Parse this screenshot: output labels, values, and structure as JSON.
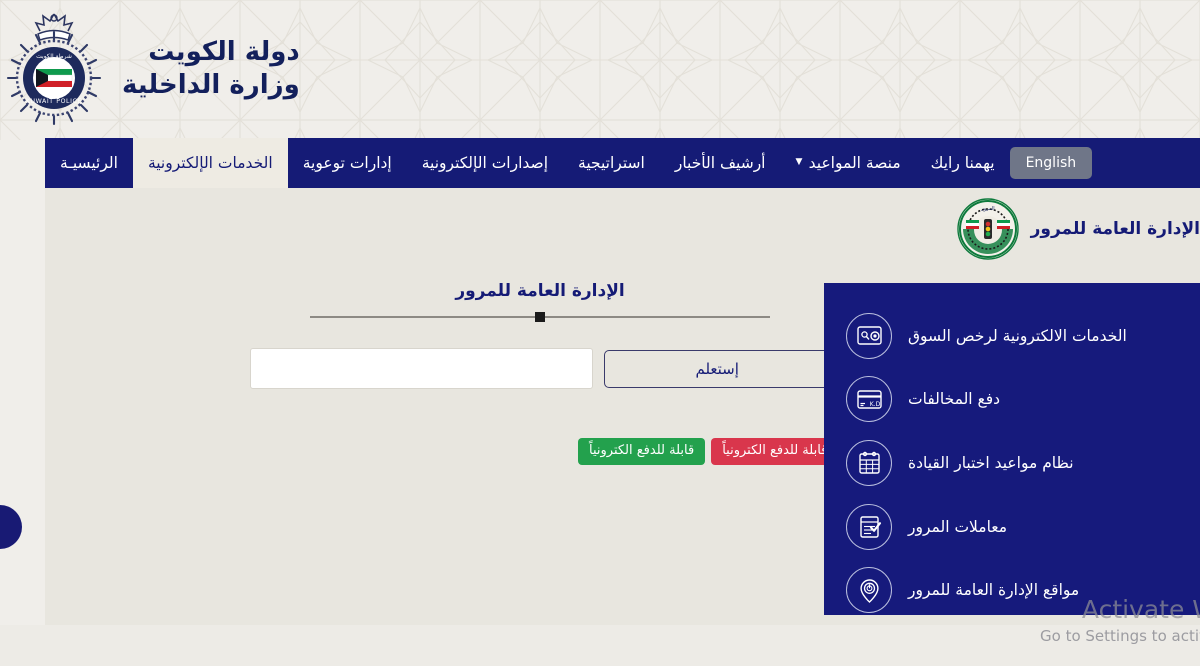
{
  "header": {
    "ministry_line1": "دولة الكويت",
    "ministry_line2": "وزارة الداخلية",
    "emblem_name": "kuwait-police-emblem",
    "emblem_text_top": "شرطــة الكويت",
    "emblem_text_bottom": "KUWAIT POLICE"
  },
  "nav": {
    "language_button": "English",
    "items": [
      {
        "label": "الرئيسيـة",
        "active": false,
        "caret": false
      },
      {
        "label": "الخدمات الإلكترونية",
        "active": true,
        "caret": false
      },
      {
        "label": "إدارات توعوية",
        "active": false,
        "caret": false
      },
      {
        "label": "إصدارات الإلكترونية",
        "active": false,
        "caret": false
      },
      {
        "label": "استراتيجية",
        "active": false,
        "caret": false
      },
      {
        "label": "أرشيف الأخبار",
        "active": false,
        "caret": false
      },
      {
        "label": "منصة المواعيد",
        "active": false,
        "caret": true
      },
      {
        "label": "يهمنا رايك",
        "active": false,
        "caret": false
      }
    ]
  },
  "department": {
    "title": "الإدارة العامة للمرور",
    "emblem_name": "traffic-department-emblem"
  },
  "query": {
    "title": "الإدارة العامة للمرور",
    "button_label": "إستعلم",
    "input_value": "",
    "input_placeholder": ""
  },
  "legend": {
    "payable": "قابلة للدفع الكترونياً",
    "not_payable": "غير قابلة للدفع الكترونياً",
    "payable_color": "#23a14d",
    "not_payable_color": "#d9364c"
  },
  "services": {
    "items": [
      {
        "label": "الخدمات الالكترونية لرخص السوق",
        "icon": "license-card-icon"
      },
      {
        "label": "دفع المخالفات",
        "icon": "payment-card-kd-icon"
      },
      {
        "label": "نظام مواعيد اختبار القيادة",
        "icon": "calendar-booking-icon"
      },
      {
        "label": "معاملات المرور",
        "icon": "document-check-icon"
      },
      {
        "label": "مواقع الإدارة العامة للمرور",
        "icon": "location-pin-icon"
      }
    ]
  },
  "watermark": {
    "line1": "Activate Windows",
    "line2": "Go to Settings to activate Windows"
  },
  "colors": {
    "navy": "#151b76",
    "panel_beige": "#e8e6df",
    "page_beige": "#f0eeea",
    "active_tab": "#eeebe3"
  }
}
